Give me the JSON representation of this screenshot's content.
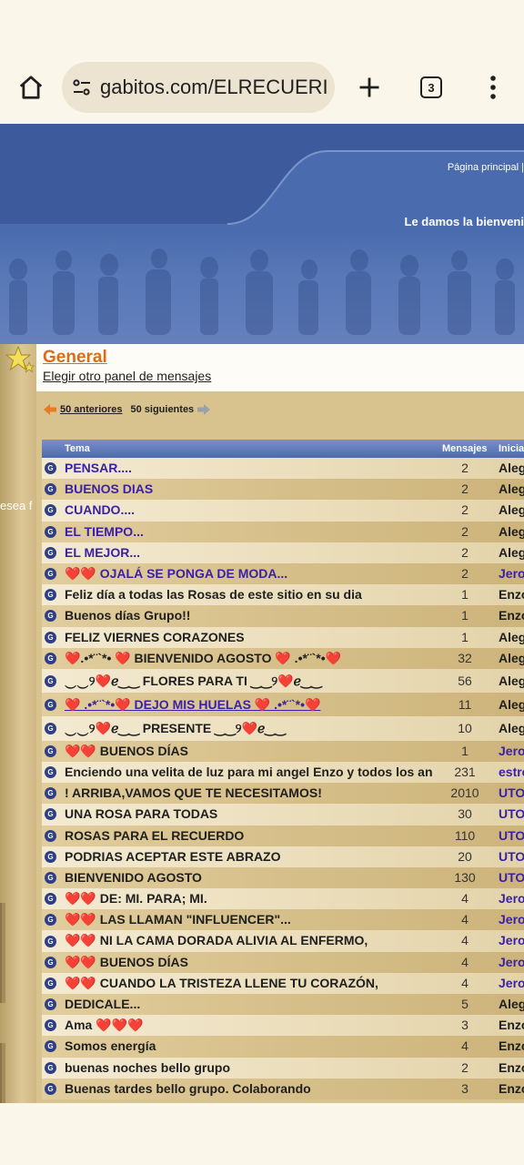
{
  "browser": {
    "url": "gabitos.com/ELRECUERI",
    "tab_count": "3"
  },
  "banner": {
    "links": "Página principal  |",
    "welcome": "Le damos la bienveni"
  },
  "sidebar": {
    "desea_text": "esea f"
  },
  "forum": {
    "title": "General",
    "choose_panel": "Elegir otro panel de mensajes"
  },
  "pager": {
    "prev": "50 anteriores",
    "next": "50 siguientes"
  },
  "table": {
    "columns": {
      "topic": "Tema",
      "messages": "Mensajes",
      "started_by": "Inicia"
    },
    "rows": [
      {
        "title": "PENSAR....",
        "count": "2",
        "starter": "Aleg",
        "title_color": "#3a1fa8",
        "starter_color": "#1f1f1f"
      },
      {
        "title": "BUENOS DIAS",
        "count": "2",
        "starter": "Aleg",
        "title_color": "#3a1fa8",
        "starter_color": "#1f1f1f"
      },
      {
        "title": "CUANDO....",
        "count": "2",
        "starter": "Aleg",
        "title_color": "#3a1fa8",
        "starter_color": "#1f1f1f"
      },
      {
        "title": "EL TIEMPO...",
        "count": "2",
        "starter": "Aleg",
        "title_color": "#3a1fa8",
        "starter_color": "#1f1f1f"
      },
      {
        "title": "EL MEJOR...",
        "count": "2",
        "starter": "Aleg",
        "title_color": "#3a1fa8",
        "starter_color": "#1f1f1f"
      },
      {
        "title": "❤️❤️ OJALÁ SE PONGA DE MODA...",
        "count": "2",
        "starter": "Jero",
        "title_color": "#3a1fa8",
        "starter_color": "#3a1fa8"
      },
      {
        "title": "Feliz día a todas las Rosas de este sitio en su dia",
        "count": "1",
        "starter": "Enzo",
        "title_color": "#1f1f1f",
        "starter_color": "#1f1f1f"
      },
      {
        "title": "Buenos días Grupo!!",
        "count": "1",
        "starter": "Enzo",
        "title_color": "#1f1f1f",
        "starter_color": "#1f1f1f"
      },
      {
        "title": "FELIZ VIERNES CORAZONES",
        "count": "1",
        "starter": "Aleg",
        "title_color": "#1f1f1f",
        "starter_color": "#1f1f1f"
      },
      {
        "title": "❤️.•*¨`*• ❤️ BIENVENIDO AGOSTO ❤️ .•*¨`*•❤️",
        "count": "32",
        "starter": "Aleg",
        "title_color": "#1f1f1f",
        "starter_color": "#1f1f1f"
      },
      {
        "title": "‿‿୨❤️ℯ‿‿ FLORES PARA TI ‿‿୨❤️ℯ‿‿",
        "count": "56",
        "starter": "Aleg",
        "title_color": "#1f1f1f",
        "starter_color": "#1f1f1f",
        "tall": true
      },
      {
        "title": "❤️ .•*¨`*•❤️ DEJO MIS HUELAS ❤️ .•*¨`*•❤️",
        "count": "11",
        "starter": "Aleg",
        "title_color": "#3a1fa8",
        "starter_color": "#1f1f1f",
        "tall": true,
        "underline": true
      },
      {
        "title": "‿‿୨❤️ℯ‿‿ PRESENTE ‿‿୨❤️ℯ‿‿",
        "count": "10",
        "starter": "Aleg",
        "title_color": "#1f1f1f",
        "starter_color": "#1f1f1f",
        "tall": true
      },
      {
        "title": "❤️❤️ BUENOS DÍAS",
        "count": "1",
        "starter": "Jero",
        "title_color": "#1f1f1f",
        "starter_color": "#3a1fa8"
      },
      {
        "title": "Enciendo una velita de luz para mi angel Enzo y todos los ang",
        "count": "231",
        "starter": "estre",
        "title_color": "#1f1f1f",
        "starter_color": "#3a1fa8"
      },
      {
        "title": "! ARRIBA,VAMOS QUE TE NECESITAMOS!",
        "count": "2010",
        "starter": "UTO",
        "title_color": "#1f1f1f",
        "starter_color": "#3a1fa8"
      },
      {
        "title": "UNA ROSA PARA TODAS",
        "count": "30",
        "starter": "UTO",
        "title_color": "#1f1f1f",
        "starter_color": "#3a1fa8"
      },
      {
        "title": "ROSAS PARA EL RECUERDO",
        "count": "110",
        "starter": "UTO",
        "title_color": "#1f1f1f",
        "starter_color": "#3a1fa8"
      },
      {
        "title": "PODRIAS ACEPTAR ESTE ABRAZO",
        "count": "20",
        "starter": "UTO",
        "title_color": "#1f1f1f",
        "starter_color": "#3a1fa8"
      },
      {
        "title": "BIENVENIDO AGOSTO",
        "count": "130",
        "starter": "UTO",
        "title_color": "#1f1f1f",
        "starter_color": "#3a1fa8"
      },
      {
        "title": "❤️❤️ DE: MI. PARA; MI.",
        "count": "4",
        "starter": "Jero",
        "title_color": "#1f1f1f",
        "starter_color": "#3a1fa8"
      },
      {
        "title": "❤️❤️ LAS LLAMAN \"INFLUENCER\"...",
        "count": "4",
        "starter": "Jero",
        "title_color": "#1f1f1f",
        "starter_color": "#3a1fa8"
      },
      {
        "title": "❤️❤️ NI LA CAMA DORADA ALIVIA AL ENFERMO,",
        "count": "4",
        "starter": "Jero",
        "title_color": "#1f1f1f",
        "starter_color": "#3a1fa8"
      },
      {
        "title": "❤️❤️ BUENOS DÍAS",
        "count": "4",
        "starter": "Jero",
        "title_color": "#1f1f1f",
        "starter_color": "#3a1fa8"
      },
      {
        "title": "❤️❤️ CUANDO LA TRISTEZA LLENE TU CORAZÓN,",
        "count": "4",
        "starter": "Jero",
        "title_color": "#1f1f1f",
        "starter_color": "#3a1fa8"
      },
      {
        "title": "DEDICALE...",
        "count": "5",
        "starter": "Aleg",
        "title_color": "#1f1f1f",
        "starter_color": "#1f1f1f"
      },
      {
        "title": "Ama ❤️❤️❤️",
        "count": "3",
        "starter": "Enzo",
        "title_color": "#1f1f1f",
        "starter_color": "#1f1f1f"
      },
      {
        "title": "Somos energía",
        "count": "4",
        "starter": "Enzo",
        "title_color": "#1f1f1f",
        "starter_color": "#1f1f1f"
      },
      {
        "title": "buenas noches bello grupo",
        "count": "2",
        "starter": "Enzo",
        "title_color": "#1f1f1f",
        "starter_color": "#1f1f1f"
      },
      {
        "title": "Buenas tardes bello grupo. Colaborando",
        "count": "3",
        "starter": "Enzo",
        "title_color": "#1f1f1f",
        "starter_color": "#1f1f1f"
      }
    ]
  },
  "colors": {
    "banner_blue": "#4667aa",
    "forum_title_orange": "#dc6c18",
    "link_purple": "#3a1fa8"
  }
}
